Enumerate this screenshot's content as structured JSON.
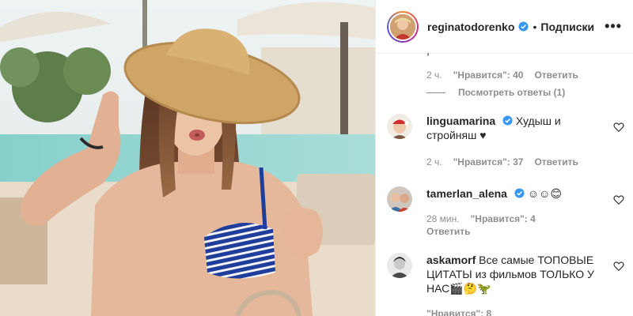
{
  "post": {
    "author": "reginatodorenko",
    "follow_label": "Подписки",
    "more_label": "•••"
  },
  "top_meta": {
    "time": "2 ч.",
    "likes": "\"Нравится\": 40",
    "reply": "Ответить",
    "view_replies": "Посмотреть ответы (1)"
  },
  "comments": [
    {
      "user": "linguamarina",
      "verified": true,
      "text": "Худыш и стройняш ♥",
      "time": "2 ч.",
      "likes": "\"Нравится\": 37",
      "reply": "Ответить"
    },
    {
      "user": "tamerlan_alena",
      "verified": true,
      "text": "☺☺😊",
      "time": "28 мин.",
      "likes": "\"Нравится\": 4",
      "reply": "Ответить"
    },
    {
      "user": "askamorf",
      "verified": false,
      "text": "Все самые ТОПОВЫЕ ЦИТАТЫ из фильмов ТОЛЬКО У НАС🎬🤔🦖",
      "time": "",
      "likes": "\"Нравится\": 8",
      "reply": ""
    }
  ],
  "colors": {
    "verified_blue": "#3897f0",
    "meta_gray": "#8e8e8e",
    "text": "#262626",
    "border": "#efefef"
  },
  "icons": {
    "verified": "verified-badge-icon",
    "heart": "heart-outline-icon",
    "more": "more-options-icon"
  }
}
